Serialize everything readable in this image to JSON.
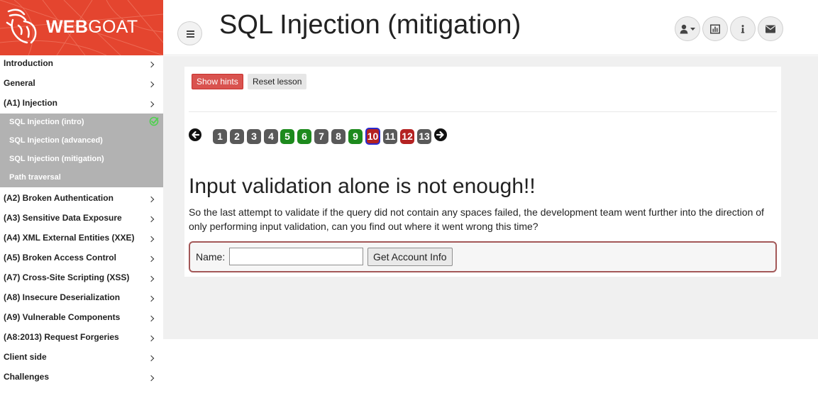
{
  "brand": {
    "name_strong": "WEB",
    "name_light": "GOAT",
    "logo_icon": "goat-logo-icon",
    "color": "#e4452f"
  },
  "header": {
    "title": "SQL Injection (mitigation)",
    "menu_toggle_icon": "hamburger-icon",
    "buttons": [
      {
        "name": "user-menu-button",
        "icon": "user-icon"
      },
      {
        "name": "report-card-button",
        "icon": "bar-chart-icon"
      },
      {
        "name": "about-button",
        "icon": "info-icon"
      },
      {
        "name": "contact-button",
        "icon": "envelope-icon"
      }
    ]
  },
  "sidebar": {
    "categories": [
      {
        "label": "Introduction"
      },
      {
        "label": "General"
      },
      {
        "label": "(A1) Injection",
        "expanded": true,
        "items": [
          {
            "label": "SQL Injection (intro)",
            "completed": true
          },
          {
            "label": "SQL Injection (advanced)",
            "completed": false
          },
          {
            "label": "SQL Injection (mitigation)",
            "completed": false
          },
          {
            "label": "Path traversal",
            "completed": false
          }
        ]
      },
      {
        "label": "(A2) Broken Authentication"
      },
      {
        "label": "(A3) Sensitive Data Exposure"
      },
      {
        "label": "(A4) XML External Entities (XXE)"
      },
      {
        "label": "(A5) Broken Access Control"
      },
      {
        "label": "(A7) Cross-Site Scripting (XSS)"
      },
      {
        "label": "(A8) Insecure Deserialization"
      },
      {
        "label": "(A9) Vulnerable Components"
      },
      {
        "label": "(A8:2013) Request Forgeries"
      },
      {
        "label": "Client side"
      },
      {
        "label": "Challenges"
      }
    ]
  },
  "lesson": {
    "show_hints_label": "Show hints",
    "reset_label": "Reset lesson",
    "pages": [
      {
        "label": "1",
        "status": "gray"
      },
      {
        "label": "2",
        "status": "gray"
      },
      {
        "label": "3",
        "status": "gray"
      },
      {
        "label": "4",
        "status": "gray"
      },
      {
        "label": "5",
        "status": "green"
      },
      {
        "label": "6",
        "status": "green"
      },
      {
        "label": "7",
        "status": "gray"
      },
      {
        "label": "8",
        "status": "gray"
      },
      {
        "label": "9",
        "status": "green"
      },
      {
        "label": "10",
        "status": "current"
      },
      {
        "label": "11",
        "status": "gray"
      },
      {
        "label": "12",
        "status": "red"
      },
      {
        "label": "13",
        "status": "gray"
      }
    ],
    "heading": "Input validation alone is not enough!!",
    "text": "So the last attempt to validate if the query did not contain any spaces failed, the development team went further into the direction of only performing input validation, can you find out where it went wrong this time?",
    "form": {
      "name_label": "Name:",
      "name_value": "",
      "submit_label": "Get Account Info"
    }
  },
  "colors": {
    "accent": "#e4452f",
    "sidebar_sub_bg": "#b2b2b2",
    "page_green": "#1d8a1d",
    "page_red": "#b42222",
    "page_gray": "#595959"
  }
}
